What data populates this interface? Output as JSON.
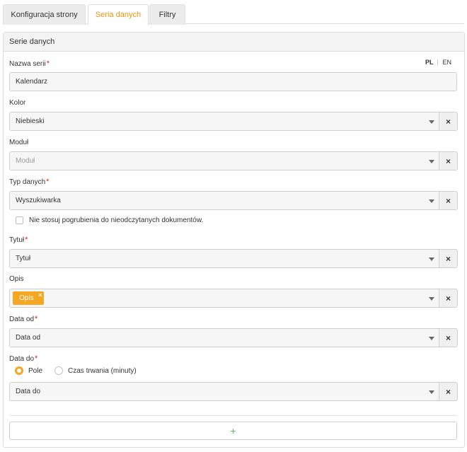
{
  "tabs": [
    {
      "label": "Konfiguracja strony"
    },
    {
      "label": "Seria danych"
    },
    {
      "label": "Filtry"
    }
  ],
  "panel": {
    "title": "Serie danych"
  },
  "lang": {
    "pl": "PL",
    "en": "EN"
  },
  "fields": {
    "nazwa": {
      "label": "Nazwa serii",
      "required_mark": "*",
      "value": "Kalendarz"
    },
    "kolor": {
      "label": "Kolor",
      "value": "Niebieski"
    },
    "modul": {
      "label": "Moduł",
      "placeholder": "Moduł"
    },
    "typ": {
      "label": "Typ danych",
      "required_mark": "*",
      "value": "Wyszukiwarka"
    },
    "checkbox": {
      "label": "Nie stosuj pogrubienia do nieodczytanych dokumentów.",
      "checked": false
    },
    "tytul": {
      "label": "Tytuł",
      "required_mark": "*",
      "value": "Tytuł"
    },
    "opis": {
      "label": "Opis",
      "tag": "Opis",
      "tag_remove": "×"
    },
    "data_od": {
      "label": "Data od",
      "required_mark": "*",
      "value": "Data od"
    },
    "data_do": {
      "label": "Data do",
      "required_mark": "*",
      "radio_options": [
        {
          "label": "Pole",
          "checked": true
        },
        {
          "label": "Czas trwania (minuty)",
          "checked": false
        }
      ],
      "value": "Data do"
    }
  },
  "clear_glyph": "×",
  "add_button": {
    "glyph": "+"
  },
  "colors": {
    "accent": "#f5a623",
    "required": "#e02020",
    "add": "#5cb85c"
  }
}
